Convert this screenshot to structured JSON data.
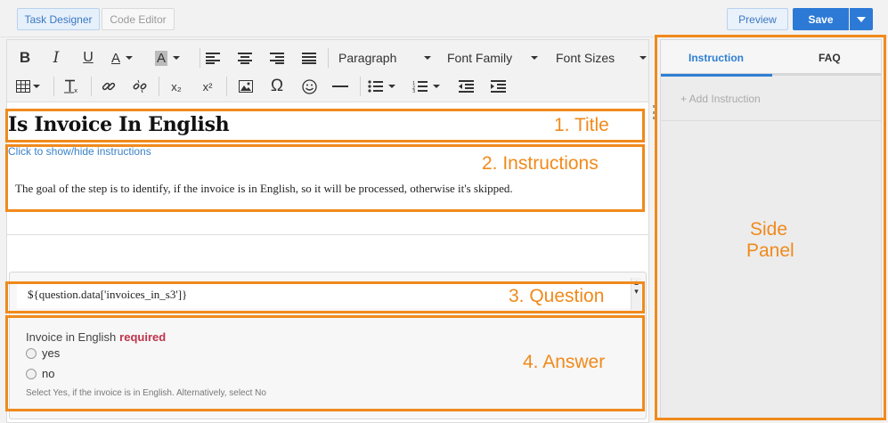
{
  "header": {
    "tab_task_designer": "Task Designer",
    "tab_code_editor": "Code Editor",
    "preview_label": "Preview",
    "save_label": "Save"
  },
  "toolbar": {
    "paragraph": "Paragraph",
    "font_family": "Font Family",
    "font_sizes": "Font Sizes",
    "bold": "B",
    "italic": "I",
    "underline": "U",
    "font_color": "A",
    "bg_color": "A",
    "special_char": "Ω",
    "subscript": "x₂",
    "superscript": "x²"
  },
  "content": {
    "title": "Is Invoice In English",
    "toggle_link": "Click to show/hide instructions",
    "instructions": "The goal of the step is to identify, if the invoice is in English, so it will be processed, otherwise it's skipped.",
    "question": "${question.data['invoices_in_s3']}",
    "answer_label": "Invoice in English",
    "answer_required": "required",
    "option_yes": "yes",
    "option_no": "no",
    "answer_help": "Select Yes, if the invoice is in English. Alternatively, select No"
  },
  "side_panel": {
    "tab_instruction": "Instruction",
    "tab_faq": "FAQ",
    "add_instruction": "+ Add Instruction"
  },
  "annotations": {
    "title": "1. Title",
    "instructions": "2. Instructions",
    "question": "3. Question",
    "answer": "4. Answer",
    "side_panel_line1": "Side",
    "side_panel_line2": "Panel"
  },
  "colors": {
    "accent_blue": "#2d7ad6",
    "annotation_orange": "#f08a1c",
    "required_red": "#c0334c"
  }
}
